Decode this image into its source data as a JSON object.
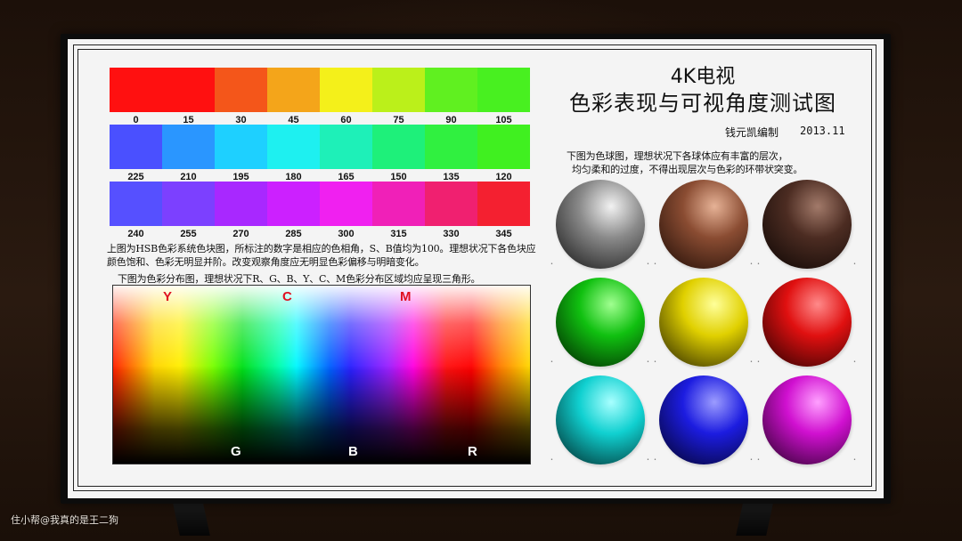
{
  "title": {
    "line1": "4K电视",
    "line2": "色彩表现与可视角度测试图",
    "author": "钱元凯编制",
    "date": "2013.11"
  },
  "hue_rows": [
    {
      "labels": [
        "0",
        "15",
        "30",
        "45",
        "60",
        "75",
        "90",
        "105"
      ],
      "colors": [
        "#ff1010",
        "#ff1010",
        "#f4561a",
        "#f4a51a",
        "#f4f01a",
        "#bbf01a",
        "#60f020",
        "#48f020"
      ]
    },
    {
      "labels": [
        "225",
        "210",
        "195",
        "180",
        "165",
        "150",
        "135",
        "120"
      ],
      "colors": [
        "#4a50ff",
        "#2a96ff",
        "#1ed0ff",
        "#1ef0f0",
        "#1ef0b8",
        "#1ef07a",
        "#30f040",
        "#40f020"
      ]
    },
    {
      "labels": [
        "240",
        "255",
        "270",
        "285",
        "300",
        "315",
        "330",
        "345"
      ],
      "colors": [
        "#5650ff",
        "#7c40ff",
        "#a828ff",
        "#cc20ff",
        "#f020f0",
        "#f020b8",
        "#f02070",
        "#f42030"
      ]
    }
  ],
  "hue_description": "上图为HSB色彩系统色块图，所标注的数字是相应的色相角，S、B值均为100。理想状况下各色块应颜色饱和、色彩无明显并阶。改变观察角度应无明显色彩偏移与明暗变化。",
  "distribution_description": "下图为色彩分布图，理想状况下R、G、B、Y、C、M色彩分布区域均应呈现三角形。",
  "distribution_labels": {
    "top": [
      "Y",
      "C",
      "M"
    ],
    "bottom": [
      "G",
      "B",
      "R"
    ]
  },
  "sphere_description": {
    "line1": "下图为色球图，理想状况下各球体应有丰富的层次，",
    "line2": "均匀柔和的过度，不得出现层次与色彩的环带状突变。"
  },
  "spheres": [
    {
      "name": "gray",
      "base": "#8a8a8a",
      "light": "#f2f2f2",
      "dark": "#101010"
    },
    {
      "name": "brown",
      "base": "#8a4c32",
      "light": "#e6b296",
      "dark": "#1a0a04"
    },
    {
      "name": "dark-brown",
      "base": "#4c2c22",
      "light": "#a27a6a",
      "dark": "#0a0402"
    },
    {
      "name": "green",
      "base": "#10c010",
      "light": "#a0ff90",
      "dark": "#001800"
    },
    {
      "name": "yellow",
      "base": "#e0d000",
      "light": "#ffff9a",
      "dark": "#201c00"
    },
    {
      "name": "red",
      "base": "#e01010",
      "light": "#ff8a8a",
      "dark": "#200000"
    },
    {
      "name": "cyan",
      "base": "#10d0d0",
      "light": "#a8ffff",
      "dark": "#002020"
    },
    {
      "name": "blue",
      "base": "#1c1ce0",
      "light": "#9c9cff",
      "dark": "#020220"
    },
    {
      "name": "magenta",
      "base": "#d010d0",
      "light": "#ffa0ff",
      "dark": "#200020"
    }
  ],
  "watermark": "住小帮@我真的是王二狗"
}
